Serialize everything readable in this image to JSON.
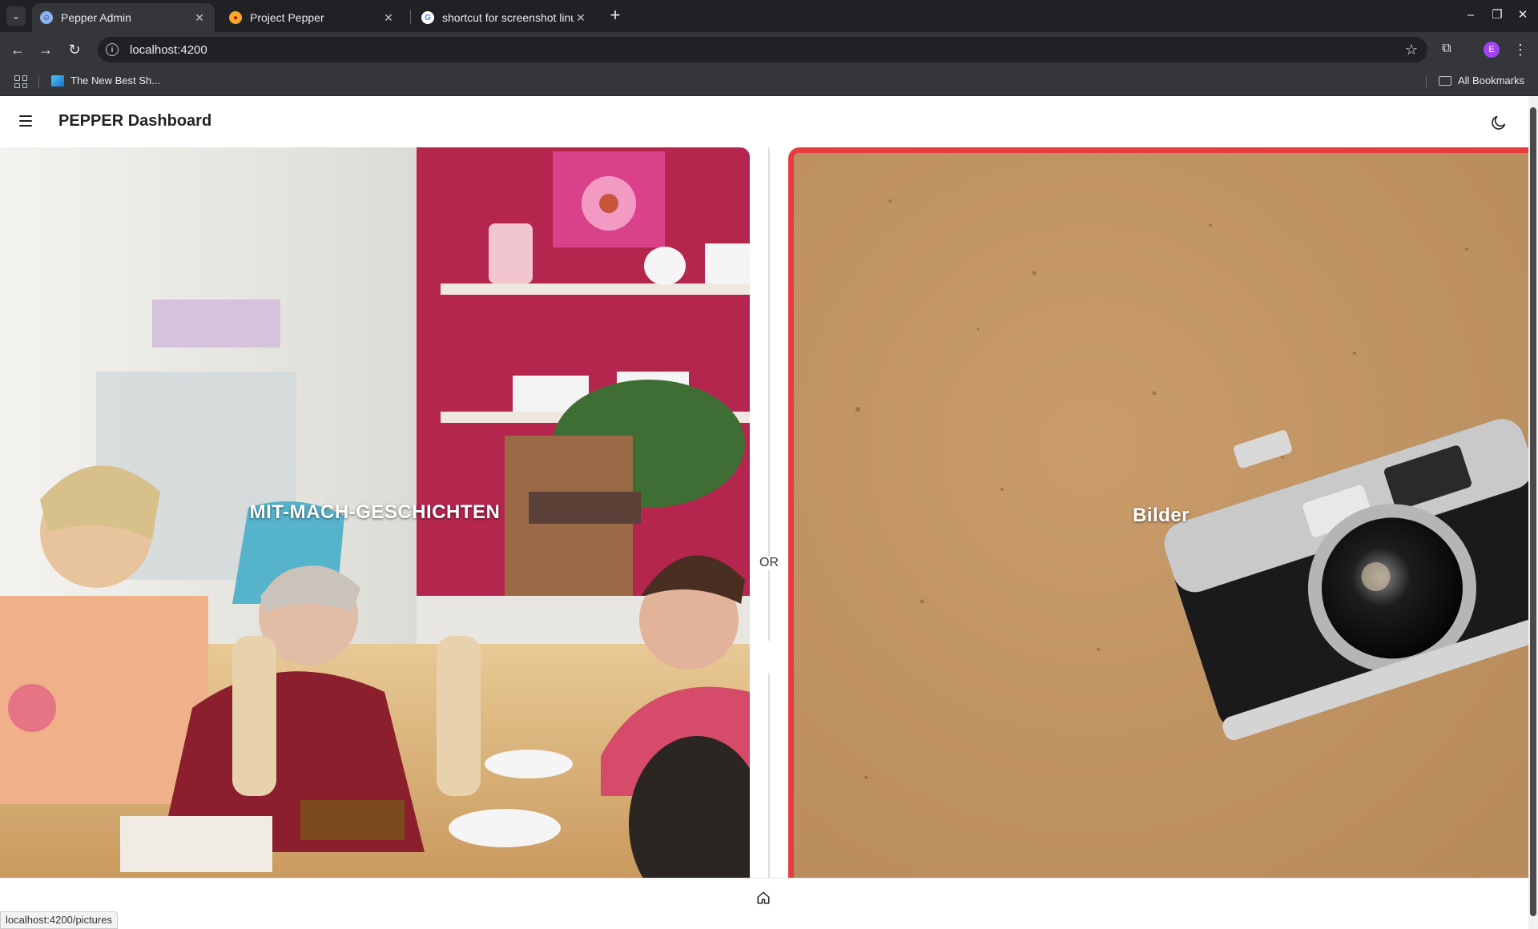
{
  "browser": {
    "tabs": [
      {
        "title": "Pepper Admin",
        "active": true,
        "icon": "pepper-admin-icon"
      },
      {
        "title": "Project Pepper",
        "active": false,
        "icon": "pepper-project-icon"
      },
      {
        "title": "shortcut for screenshot linu",
        "active": false,
        "icon": "google-icon"
      }
    ],
    "url": "localhost:4200",
    "bookmark": "The New Best Sh...",
    "all_bookmarks": "All Bookmarks",
    "profile_initial": "E",
    "status_url": "localhost:4200/pictures"
  },
  "app": {
    "title": "PEPPER Dashboard",
    "cards": [
      {
        "label": "MIT-MACH-GESCHICHTEN",
        "selected": false
      },
      {
        "label": "Bilder",
        "selected": true
      }
    ],
    "divider_text": "OR",
    "colors": {
      "selected_border": "#e53e3e"
    }
  }
}
